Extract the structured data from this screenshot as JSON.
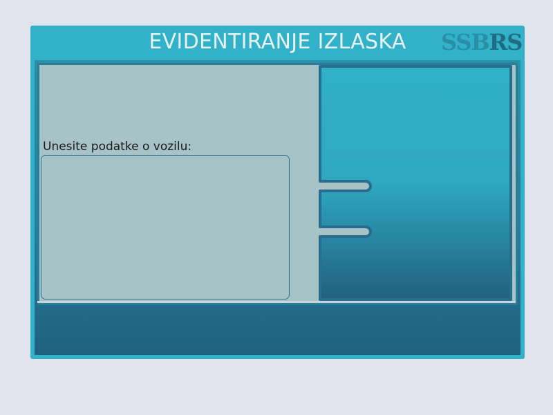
{
  "window": {
    "title": "EVIDENTIRANJE IZLASKA",
    "logo": {
      "part1": "SSB",
      "part2": "RS"
    }
  },
  "form": {
    "vehicle_label": "Unesite podatke o vozilu:",
    "vehicle_input_value": "",
    "vehicle_input_placeholder": ""
  },
  "colors": {
    "page_background": "#e1e4ec",
    "frame": "#31b2c9",
    "content_background": "#a7c3c7",
    "panel_top": "#31b2c9",
    "panel_bottom": "#21607f",
    "border": "#2a7d99"
  },
  "icons": {
    "side_panel": "tabbed-panel-shape"
  }
}
